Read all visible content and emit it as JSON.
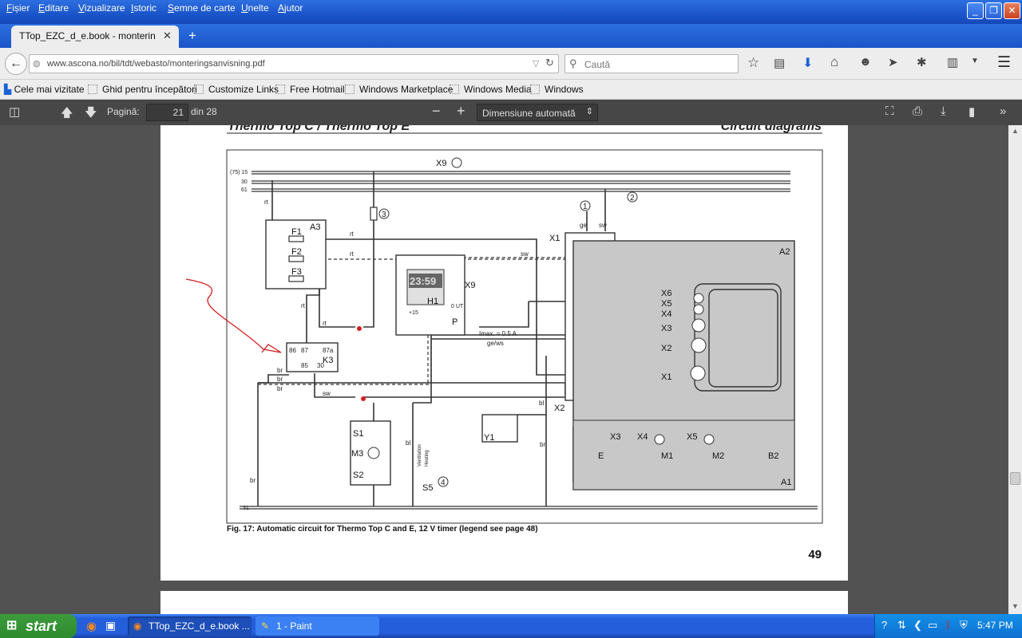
{
  "menu": [
    "Fișier",
    "Editare",
    "Vizualizare",
    "Istoric",
    "Semne de carte",
    "Unelte",
    "Ajutor"
  ],
  "tab": {
    "title": "TTop_EZC_d_e.book - monterings..."
  },
  "url": "www.ascona.no/bil/tdt/webasto/monteringsanvisning.pdf",
  "search_placeholder": "Caută",
  "bookmarks": [
    "Cele mai vizitate",
    "Ghid pentru începători",
    "Customize Links",
    "Free Hotmail",
    "Windows Marketplace",
    "Windows Media",
    "Windows"
  ],
  "pdf": {
    "page_label": "Pagină:",
    "page": "21",
    "of": "din 28",
    "zoom": "Dimensiune automată"
  },
  "doc": {
    "header_left": "Thermo Top C / Thermo Top E",
    "header_right": "Circuit diagrams",
    "caption": "Fig. 17:   Automatic circuit for Thermo Top C and E, 12 V timer (legend see page 48)",
    "page_number": "49",
    "labels": {
      "x9": "X9",
      "a3": "A3",
      "f1": "F1",
      "f2": "F2",
      "f3": "F3",
      "rt1": "rt",
      "rt2": "rt",
      "rt3": "rt",
      "rt4": "rt",
      "rt5": "rt",
      "sw1": "sw",
      "sw2": "sw",
      "sw3": "sw",
      "ge": "ge",
      "x1": "X1",
      "a2": "A2",
      "x6": "X6",
      "x5": "X5",
      "x4": "X4",
      "x3": "X3",
      "x2": "X2",
      "x1b": "X1",
      "h1": "H1",
      "p": "P",
      "x9b": "X9",
      "clock": "23:59",
      "imax": "Imax. = 0.5 A",
      "gnws": "ge/ws",
      "k3": "K3",
      "r86": "86",
      "r87": "87",
      "r87a": "87a",
      "r85": "85",
      "r30": "30",
      "br1": "br",
      "br2": "br",
      "br3": "br",
      "bl1": "bl",
      "bl2": "bl",
      "br4": "br",
      "br5": "br",
      "s1": "S1",
      "m3": "M3",
      "s2": "S2",
      "s5": "S5",
      "y1": "Y1",
      "x2b": "X2",
      "a1": "A1",
      "x3b": "X3",
      "x4b": "X4",
      "x5b": "X5",
      "e": "E",
      "m1": "M1",
      "m2": "M2",
      "b2": "B2",
      "c1": "1",
      "c2": "2",
      "c3": "3",
      "c4": "4",
      "vent": "Ventilation",
      "heat": "Heating",
      "l15": "(75) 15",
      "l30": "30",
      "l61": "61",
      "l31": "31",
      "out": "0 UT",
      "plus15": "+15"
    }
  },
  "taskbar": {
    "start": "start",
    "tasks": [
      "TTop_EZC_d_e.book ...",
      "1 - Paint"
    ],
    "clock": "5:47 PM"
  }
}
